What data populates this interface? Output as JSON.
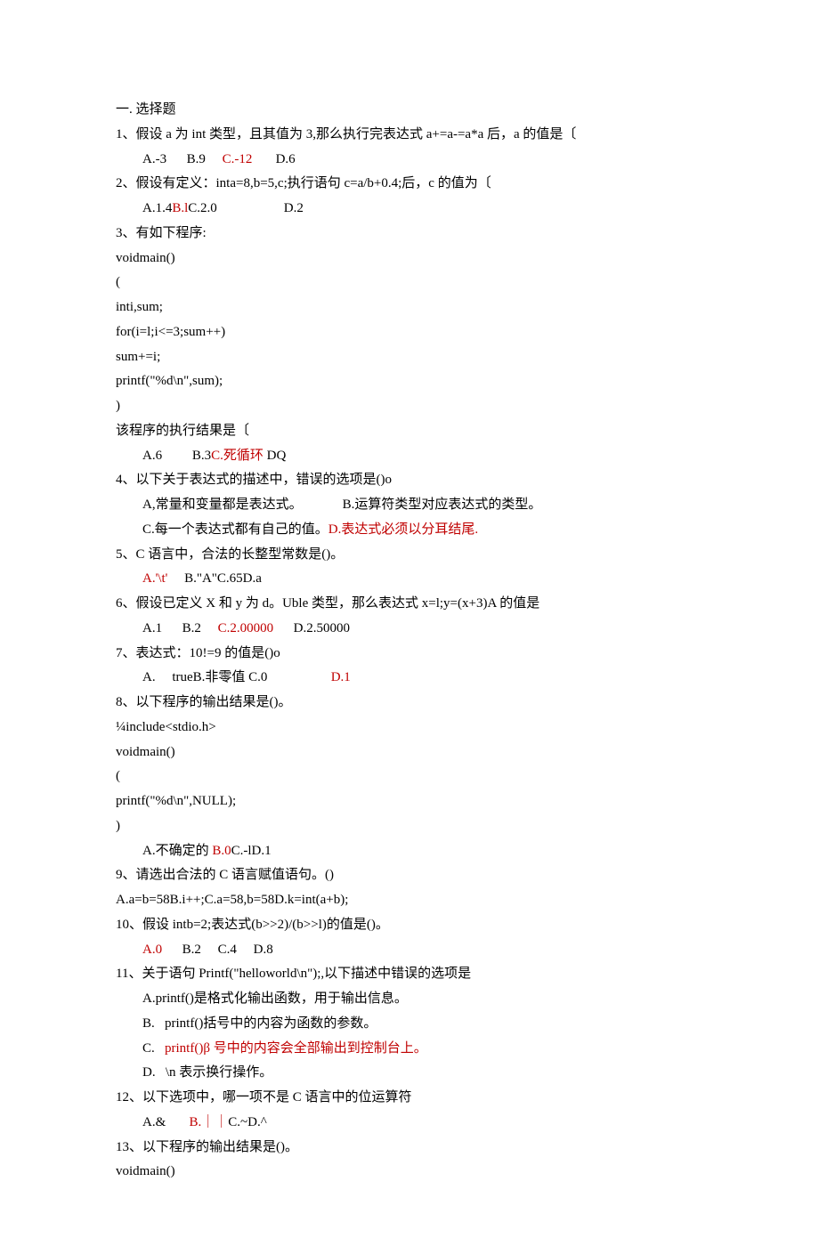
{
  "heading": "一. 选择题",
  "q1_text": "1、假设 a 为 int 类型，且其值为 3,那么执行完表达式 a+=a-=a*a 后，a 的值是〔",
  "q1_a": "A.-3",
  "q1_b": "B.9",
  "q1_c": "C.-12",
  "q1_d": "D.6",
  "q2_text": "2、假设有定义：inta=8,b=5,c;执行语句 c=a/b+0.4;后，c 的值为〔",
  "q2_a": "A.1.4",
  "q2_b": "B.l",
  "q2_c": "C.2.0",
  "q2_d": "D.2",
  "q3_text": "3、有如下程序:",
  "q3_code1": "voidmain()",
  "q3_code2": "(",
  "q3_code3": "inti,sum;",
  "q3_code4": "for(i=l;i<=3;sum++)",
  "q3_code5": "sum+=i;",
  "q3_code6": "printf(\"%d\\n\",sum);",
  "q3_code7": ")",
  "q3_result": "该程序的执行结果是〔",
  "q3_a": "A.6",
  "q3_b": "B.3",
  "q3_c": "C.死循环",
  "q3_d": " DQ",
  "q4_text": "4、以下关于表达式的描述中，错误的选项是()o",
  "q4_a": "A,常量和变量都是表达式。",
  "q4_b": "B.运算符类型对应表达式的类型。",
  "q4_c": "C.每一个表达式都有自己的值。",
  "q4_d": "D.表达式必须以分耳结尾.",
  "q5_text": "5、C 语言中，合法的长整型常数是()。",
  "q5_a": "A.'\\t'",
  "q5_rest": "B.\"A\"C.65D.a",
  "q6_text": "6、假设已定义 X 和 y 为 d。Uble 类型，那么表达式 x=l;y=(x+3)A 的值是",
  "q6_a": "A.1",
  "q6_b": "B.2",
  "q6_c": "C.2.00000",
  "q6_d": "D.2.50000",
  "q7_text": "7、表达式：10!=9 的值是()o",
  "q7_a": "A.",
  "q7_ab": "trueB.非零值 C.0",
  "q7_d": "D.1",
  "q8_text": "8、以下程序的输出结果是()。",
  "q8_code1": "¼include<stdio.h>",
  "q8_code2": "voidmain()",
  "q8_code3": "(",
  "q8_code4": "printf(\"%d\\n\",NULL);",
  "q8_code5": ")",
  "q8_a": "A.不确定的 ",
  "q8_b": "B.0",
  "q8_rest": "C.-lD.1",
  "q9_text": "9、请选出合法的 C 语言赋值语句。()",
  "q9_opts": "A.a=b=58B.i++;C.a=58,b=58D.k=int(a+b);",
  "q10_text": "10、假设 intb=2;表达式(b>>2)/(b>>l)的值是()。",
  "q10_a": "A.0",
  "q10_b": "B.2",
  "q10_c": "C.4",
  "q10_d": "D.8",
  "q11_text": "11、关于语句 Printf(\"helloworld\\n\");,以下描述中错误的选项是",
  "q11_a": "A.printf()是格式化输出函数，用于输出信息。",
  "q11_b_pre": "B.",
  "q11_b": "printf()括号中的内容为函数的参数。",
  "q11_c_pre": "C.",
  "q11_c": "printf()β 号中的内容会全部输出到控制台上。",
  "q11_d_pre": "D.",
  "q11_d": "\\n 表示换行操作。",
  "q12_text": "12、以下选项中，哪一项不是 C 语言中的位运算符",
  "q12_a": "A.&",
  "q12_b": "B.｜｜",
  "q12_rest": "C.~D.^",
  "q13_text": "13、以下程序的输出结果是()。",
  "q13_code1": "voidmain()"
}
